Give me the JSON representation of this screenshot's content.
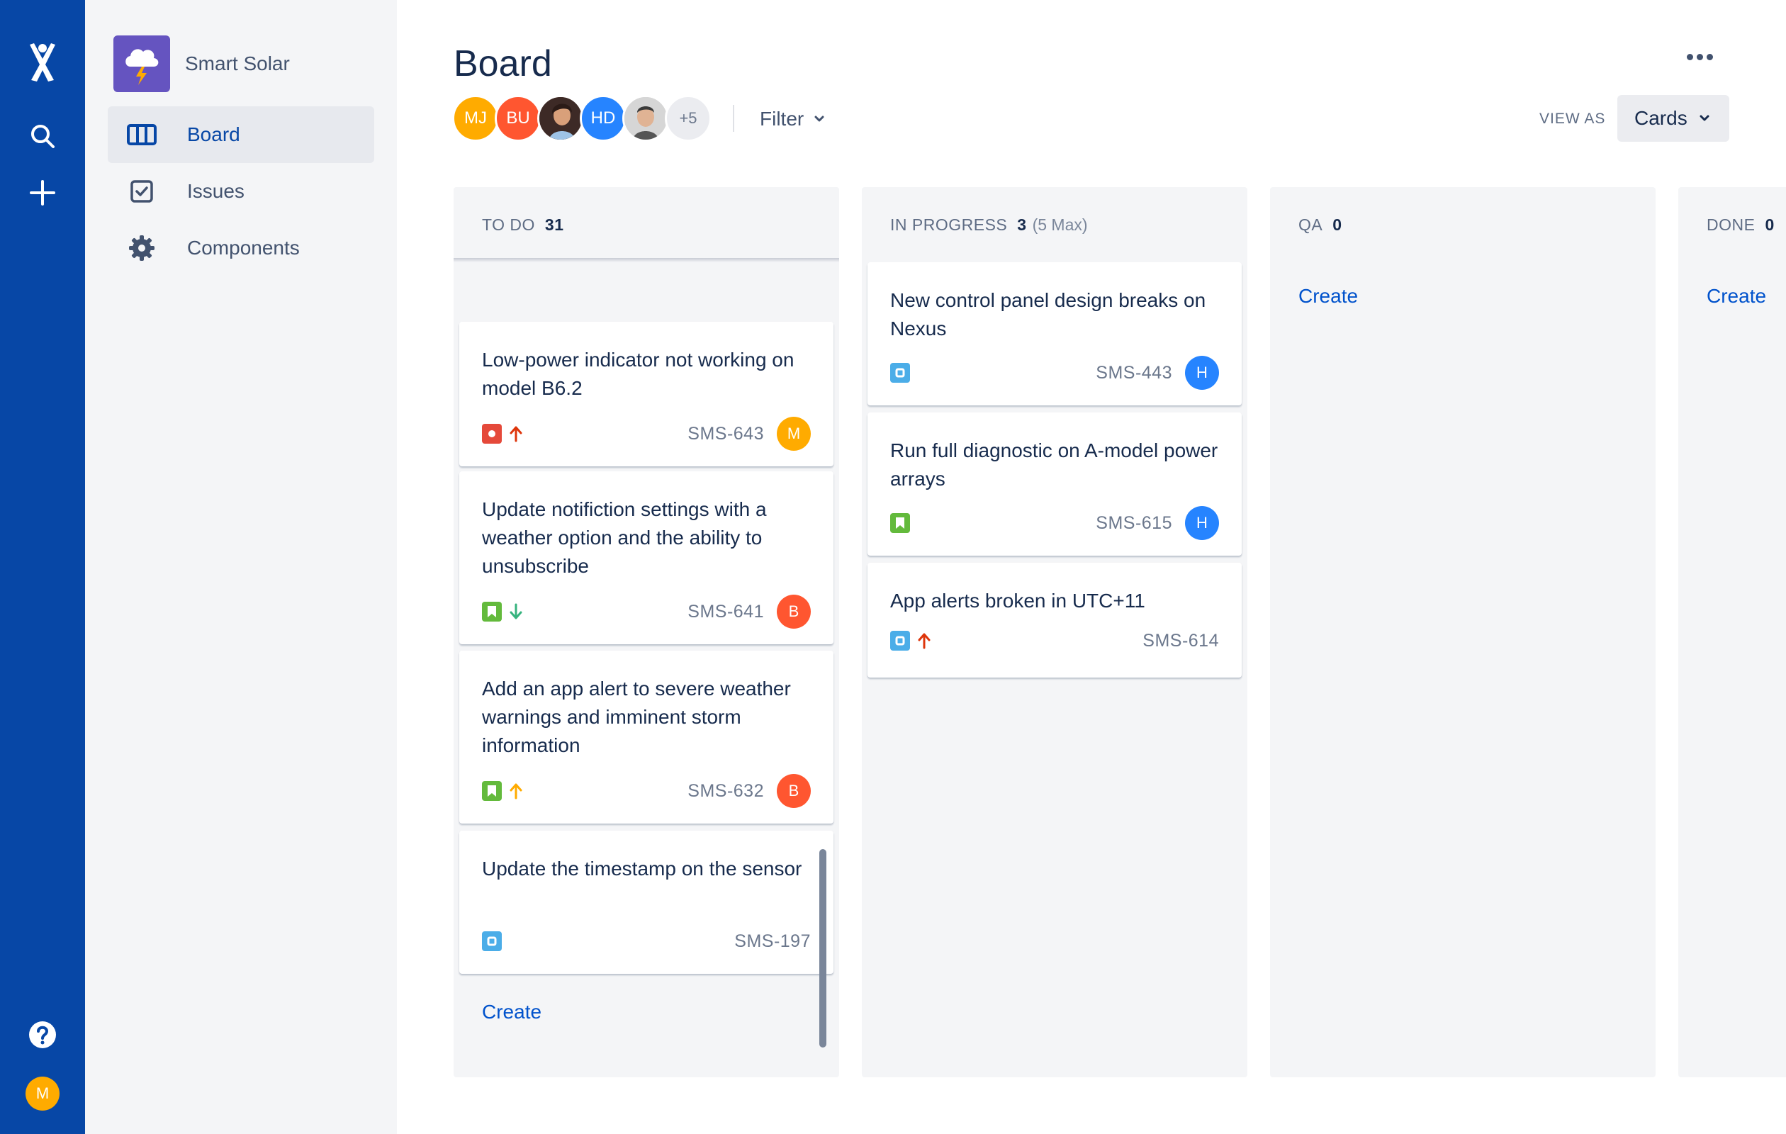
{
  "global_nav": {
    "icons": [
      "atlassian-logo-icon",
      "search-icon",
      "plus-icon",
      "help-icon"
    ],
    "user_initial": "M"
  },
  "project": {
    "name": "Smart Solar",
    "nav": [
      {
        "label": "Board",
        "icon": "board-icon",
        "active": true
      },
      {
        "label": "Issues",
        "icon": "checkbox-icon",
        "active": false
      },
      {
        "label": "Components",
        "icon": "gear-icon",
        "active": false
      }
    ]
  },
  "header": {
    "title": "Board",
    "avatars": [
      {
        "initials": "MJ",
        "color": "#ffab00"
      },
      {
        "initials": "BU",
        "color": "#ff5630"
      },
      {
        "initials": "",
        "photo": true
      },
      {
        "initials": "HD",
        "color": "#2684ff"
      },
      {
        "initials": "",
        "photo": true
      },
      {
        "initials": "+5",
        "color": "#ebecf0"
      }
    ],
    "filter_label": "Filter",
    "view_as_label": "VIEW AS",
    "view_as_value": "Cards"
  },
  "columns": [
    {
      "name": "TO DO",
      "count": "31",
      "max": "",
      "create_label": "Create",
      "cards": [
        {
          "title": "",
          "type": "story",
          "priority": "",
          "key": "",
          "assignee": ""
        },
        {
          "title": "Low-power indicator not working on model B6.2",
          "type": "bug",
          "priority": "high",
          "key": "SMS-643",
          "assignee": "M"
        },
        {
          "title": "Update notifiction settings with a weather option and the ability to unsubscribe",
          "type": "story",
          "priority": "low",
          "key": "SMS-641",
          "assignee": "B"
        },
        {
          "title": "Add an app alert to severe weather warnings and imminent storm information",
          "type": "story",
          "priority": "medium",
          "key": "SMS-632",
          "assignee": "B"
        },
        {
          "title": "Update the timestamp on the sensor",
          "type": "task",
          "priority": "",
          "key": "SMS-197",
          "assignee": ""
        }
      ]
    },
    {
      "name": "IN PROGRESS",
      "count": "3",
      "max": "(5 Max)",
      "cards": [
        {
          "title": "New control panel design breaks on Nexus",
          "type": "task",
          "priority": "",
          "key": "SMS-443",
          "assignee": "H"
        },
        {
          "title": "Run full diagnostic on A-model power arrays",
          "type": "story",
          "priority": "",
          "key": "SMS-615",
          "assignee": "H"
        },
        {
          "title": "App alerts broken in UTC+11",
          "type": "task",
          "priority": "high",
          "key": "SMS-614",
          "assignee": ""
        }
      ]
    },
    {
      "name": "QA",
      "count": "0",
      "create_label": "Create"
    },
    {
      "name": "DONE",
      "count": "0",
      "create_label": "Create"
    }
  ],
  "colors": {
    "nav_blue": "#0747a6",
    "link_blue": "#0052cc",
    "story_green": "#63ba3c",
    "task_blue": "#4bade8",
    "bug_red": "#e5493a",
    "avatar_orange": "#ffab00",
    "avatar_red": "#ff5630",
    "avatar_blue": "#2684ff"
  }
}
